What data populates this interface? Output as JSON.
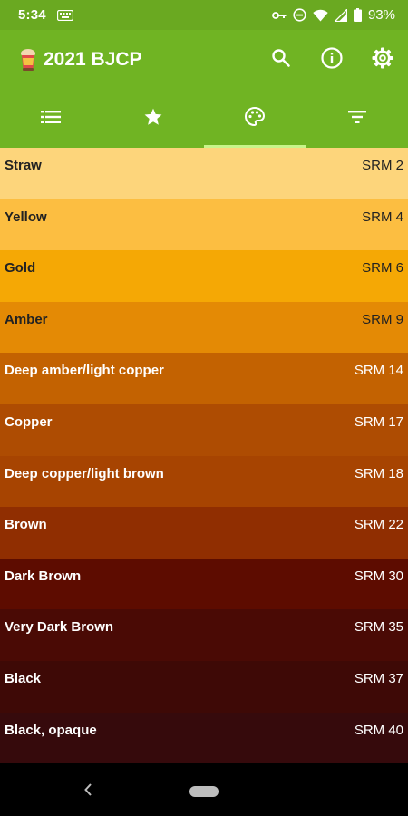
{
  "status": {
    "time": "5:34",
    "battery": "93%"
  },
  "app": {
    "title": "2021 BJCP"
  },
  "icons": {
    "search": "search-icon",
    "info": "info-icon",
    "settings": "gear-icon",
    "list_tab": "list-icon",
    "favorites_tab": "star-icon",
    "colors_tab": "palette-icon",
    "filter_tab": "filter-icon"
  },
  "colors": {
    "accent": "#70b423",
    "tab_indicator": "#c8f58a"
  },
  "srm_colors": [
    {
      "name": "Straw",
      "srm": "SRM 2",
      "bg": "#fdd57b",
      "fg": "#222222"
    },
    {
      "name": "Yellow",
      "srm": "SRM 4",
      "bg": "#fcbe41",
      "fg": "#222222"
    },
    {
      "name": "Gold",
      "srm": "SRM 6",
      "bg": "#f5a805",
      "fg": "#222222"
    },
    {
      "name": "Amber",
      "srm": "SRM 9",
      "bg": "#e48a05",
      "fg": "#222222"
    },
    {
      "name": "Deep amber/light copper",
      "srm": "SRM 14",
      "bg": "#c36201",
      "fg": "#ffffff"
    },
    {
      "name": "Copper",
      "srm": "SRM 17",
      "bg": "#ae4c02",
      "fg": "#ffffff"
    },
    {
      "name": "Deep copper/light brown",
      "srm": "SRM 18",
      "bg": "#a74401",
      "fg": "#ffffff"
    },
    {
      "name": "Brown",
      "srm": "SRM 22",
      "bg": "#902e01",
      "fg": "#ffffff"
    },
    {
      "name": "Dark Brown",
      "srm": "SRM 30",
      "bg": "#5d0c00",
      "fg": "#ffffff"
    },
    {
      "name": "Very Dark Brown",
      "srm": "SRM 35",
      "bg": "#4a0a05",
      "fg": "#ffffff"
    },
    {
      "name": "Black",
      "srm": "SRM 37",
      "bg": "#3e0906",
      "fg": "#ffffff"
    },
    {
      "name": "Black, opaque",
      "srm": "SRM 40",
      "bg": "#360a0c",
      "fg": "#ffffff"
    }
  ]
}
